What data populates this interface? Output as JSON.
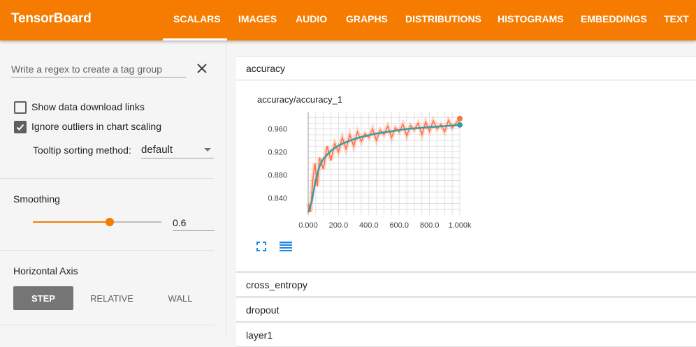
{
  "app": {
    "title": "TensorBoard"
  },
  "tabs": [
    {
      "label": "SCALARS",
      "active": true
    },
    {
      "label": "IMAGES"
    },
    {
      "label": "AUDIO"
    },
    {
      "label": "GRAPHS"
    },
    {
      "label": "DISTRIBUTIONS"
    },
    {
      "label": "HISTOGRAMS"
    },
    {
      "label": "EMBEDDINGS"
    },
    {
      "label": "TEXT"
    }
  ],
  "sidebar": {
    "regex": {
      "placeholder": "Write a regex to create a tag group",
      "value": ""
    },
    "show_download": {
      "label": "Show data download links",
      "checked": false
    },
    "ignore_outliers": {
      "label": "Ignore outliers in chart scaling",
      "checked": true
    },
    "tooltip_sort": {
      "label": "Tooltip sorting method:",
      "value": "default"
    },
    "smoothing": {
      "title": "Smoothing",
      "value": "0.6",
      "fraction": 0.6
    },
    "horizontal_axis": {
      "title": "Horizontal Axis",
      "options": [
        "STEP",
        "RELATIVE",
        "WALL"
      ],
      "selected": "STEP"
    }
  },
  "main": {
    "categories": [
      {
        "name": "accuracy",
        "expanded": true
      },
      {
        "name": "cross_entropy"
      },
      {
        "name": "dropout"
      },
      {
        "name": "layer1"
      }
    ],
    "chart": {
      "title": "accuracy/accuracy_1"
    }
  },
  "colors": {
    "accent": "#f57c00",
    "raw": "#ff7043",
    "smoothed": "#3b9ba6"
  },
  "chart_data": {
    "type": "line",
    "title": "accuracy/accuracy_1",
    "xlabel": "",
    "ylabel": "",
    "x_ticks": [
      "0.000",
      "200.0",
      "400.0",
      "600.0",
      "800.0",
      "1.000k"
    ],
    "y_ticks": [
      "0.840",
      "0.880",
      "0.920",
      "0.960"
    ],
    "xlim": [
      0,
      1000
    ],
    "ylim": [
      0.81,
      0.99
    ],
    "grid": true,
    "series": [
      {
        "x": [
          0,
          25,
          50,
          75,
          100,
          150,
          200,
          250,
          300,
          350,
          400,
          450,
          500,
          550,
          600,
          650,
          700,
          750,
          800,
          850,
          900,
          950,
          1000
        ],
        "y": [
          0.815,
          0.835,
          0.872,
          0.895,
          0.908,
          0.922,
          0.931,
          0.937,
          0.942,
          0.946,
          0.949,
          0.952,
          0.954,
          0.956,
          0.958,
          0.96,
          0.961,
          0.962,
          0.963,
          0.964,
          0.965,
          0.966,
          0.967
        ]
      },
      {
        "x": [
          0,
          15,
          30,
          45,
          60,
          75,
          100,
          125,
          150,
          175,
          200,
          225,
          250,
          275,
          300,
          325,
          350,
          375,
          400,
          425,
          450,
          475,
          500,
          525,
          550,
          575,
          600,
          625,
          650,
          675,
          700,
          725,
          750,
          775,
          800,
          825,
          850,
          875,
          900,
          925,
          950,
          975,
          1000
        ],
        "y": [
          0.83,
          0.815,
          0.87,
          0.9,
          0.86,
          0.91,
          0.89,
          0.93,
          0.905,
          0.935,
          0.92,
          0.945,
          0.925,
          0.95,
          0.93,
          0.955,
          0.938,
          0.952,
          0.945,
          0.96,
          0.94,
          0.958,
          0.95,
          0.965,
          0.945,
          0.962,
          0.955,
          0.968,
          0.948,
          0.966,
          0.958,
          0.97,
          0.95,
          0.972,
          0.956,
          0.974,
          0.96,
          0.968,
          0.955,
          0.975,
          0.962,
          0.97,
          0.978
        ]
      }
    ]
  }
}
